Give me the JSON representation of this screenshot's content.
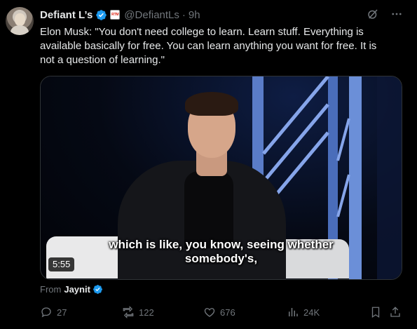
{
  "tweet": {
    "author": {
      "display_name": "Defiant L’s",
      "affiliate_badge_text": "RTM",
      "handle": "@DefiantLs",
      "separator": "·",
      "time": "9h"
    },
    "text": "Elon Musk: \"You don't need college to learn. Learn stuff. Everything is available basically for free. You can learn anything you want for free. It is not a question of learning.\"",
    "media": {
      "caption_line1": "which is like, you know, seeing whether",
      "caption_line2": "somebody's,",
      "duration": "5:55"
    },
    "from": {
      "label": "From",
      "source": "Jaynit"
    },
    "stats": {
      "replies": "27",
      "reposts": "122",
      "likes": "676",
      "views": "24K"
    }
  },
  "colors": {
    "verified_blue": "#1d9bf0",
    "muted_text": "#71767b",
    "primary_text": "#e7e9ea",
    "background": "#000000"
  },
  "icons": [
    "verified-badge-icon",
    "grok-icon",
    "more-icon",
    "reply-icon",
    "repost-icon",
    "like-icon",
    "views-icon",
    "bookmark-icon",
    "share-icon"
  ]
}
